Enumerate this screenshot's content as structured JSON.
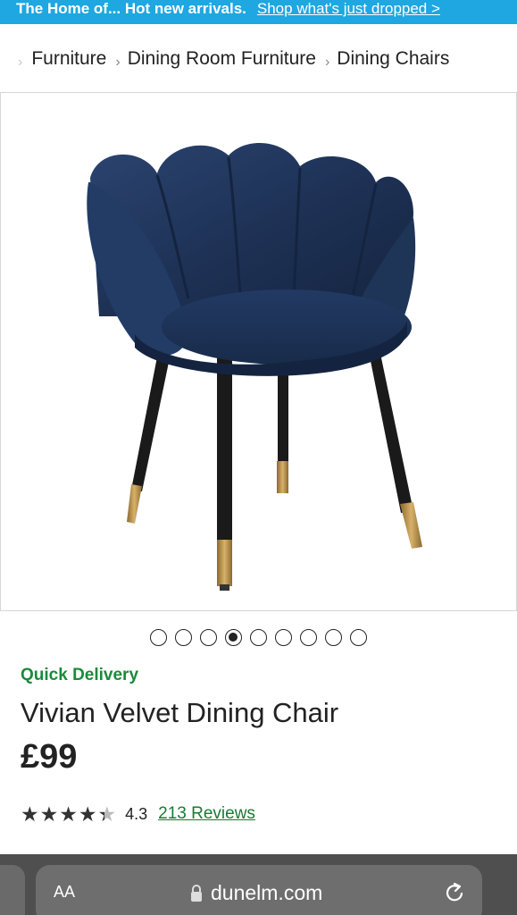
{
  "promo": {
    "text": "The Home of... Hot new arrivals.",
    "link": "Shop what's just dropped >"
  },
  "breadcrumb": {
    "items": [
      {
        "label": "Furniture"
      },
      {
        "label": "Dining Room Furniture"
      },
      {
        "label": "Dining Chairs"
      }
    ]
  },
  "gallery": {
    "image_alt": "dining-chair-image",
    "dots_total": 9,
    "active_dot": 4
  },
  "product": {
    "delivery_badge": "Quick Delivery",
    "title": "Vivian Velvet Dining Chair",
    "price": "£99",
    "rating": 4.3,
    "rating_text": "4.3",
    "reviews_label": "213 Reviews"
  },
  "browser": {
    "aa_label": "AA",
    "url": "dunelm.com",
    "icons": [
      "lock-icon",
      "reload-icon"
    ]
  },
  "colors": {
    "promo_bg": "#1ea7e0",
    "delivery_green": "#1a8a3a",
    "reviews_green": "#1a7a33",
    "chair_navy": "#1f3558"
  }
}
